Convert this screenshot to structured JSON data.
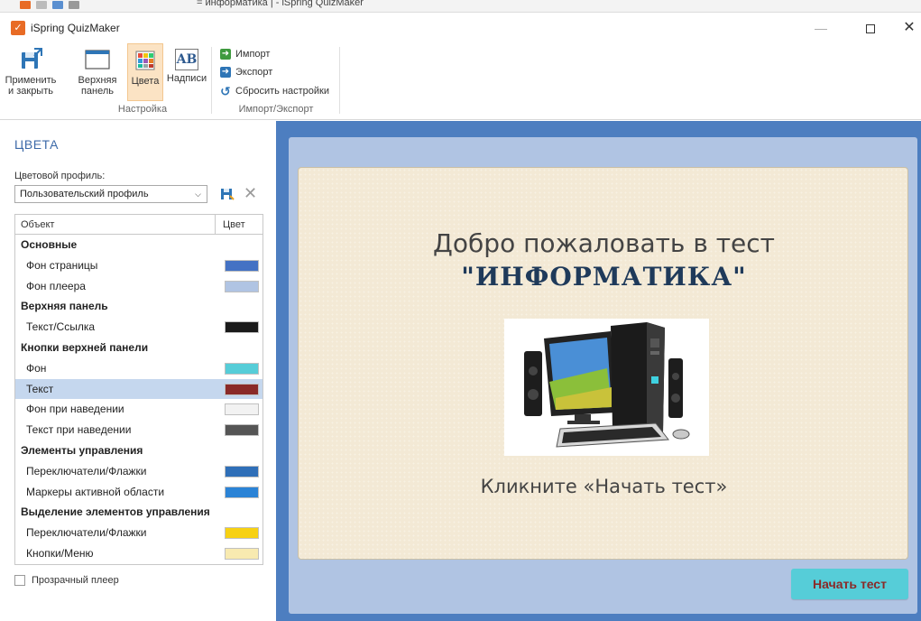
{
  "top_strip": {
    "text": "= информатика | - iSpring QuizMaker"
  },
  "window": {
    "title": "iSpring QuizMaker",
    "minimize_glyph": "—",
    "close_glyph": "✕"
  },
  "ribbon": {
    "apply_close": {
      "line1": "Применить",
      "line2": "и закрыть",
      "icon": "save-close-icon"
    },
    "top_panel": {
      "line1": "Верхняя",
      "line2": "панель",
      "icon": "top-panel-icon"
    },
    "colors": {
      "label": "Цвета",
      "icon": "palette-icon",
      "active": true
    },
    "captions": {
      "label": "Надписи",
      "icon": "captions-icon",
      "icon_text": "AB"
    },
    "group_setup": "Настройка",
    "import": "Импорт",
    "export": "Экспорт",
    "reset": "Сбросить настройки",
    "group_import_export": "Импорт/Экспорт"
  },
  "panel": {
    "title": "ЦВЕТА",
    "profile_label": "Цветовой профиль:",
    "profile_value": "Пользовательский профиль",
    "table_headers": {
      "object": "Объект",
      "color": "Цвет"
    },
    "rows": [
      {
        "type": "group",
        "label": "Основные"
      },
      {
        "type": "item",
        "label": "Фон страницы",
        "color": "#4472c4"
      },
      {
        "type": "item",
        "label": "Фон плеера",
        "color": "#b0c4e3"
      },
      {
        "type": "group",
        "label": "Верхняя панель"
      },
      {
        "type": "item",
        "label": "Текст/Ссылка",
        "color": "#1a1a1a"
      },
      {
        "type": "group",
        "label": "Кнопки верхней панели"
      },
      {
        "type": "item",
        "label": "Фон",
        "color": "#56cdd8"
      },
      {
        "type": "item",
        "label": "Текст",
        "color": "#8a2a28",
        "selected": true
      },
      {
        "type": "item",
        "label": "Фон при наведении",
        "color": "#f2f2f2"
      },
      {
        "type": "item",
        "label": "Текст при наведении",
        "color": "#555555"
      },
      {
        "type": "group",
        "label": "Элементы управления"
      },
      {
        "type": "item",
        "label": "Переключатели/Флажки",
        "color": "#2f6fb8"
      },
      {
        "type": "item",
        "label": "Маркеры активной области",
        "color": "#2b83d6"
      },
      {
        "type": "group",
        "label": "Выделение элементов управления"
      },
      {
        "type": "item",
        "label": "Переключатели/Флажки",
        "color": "#f7d113"
      },
      {
        "type": "item",
        "label": "Кнопки/Меню",
        "color": "#f8eab0"
      }
    ],
    "transparent_player": "Прозрачный плеер",
    "transparent_checked": false
  },
  "preview": {
    "title_line1": "Добро пожаловать в тест",
    "title_line2": "\"ИНФОРМАТИКА\"",
    "subtitle": "Кликните «Начать тест»",
    "start_button": "Начать тест",
    "image": "desktop-computer-illustration"
  }
}
